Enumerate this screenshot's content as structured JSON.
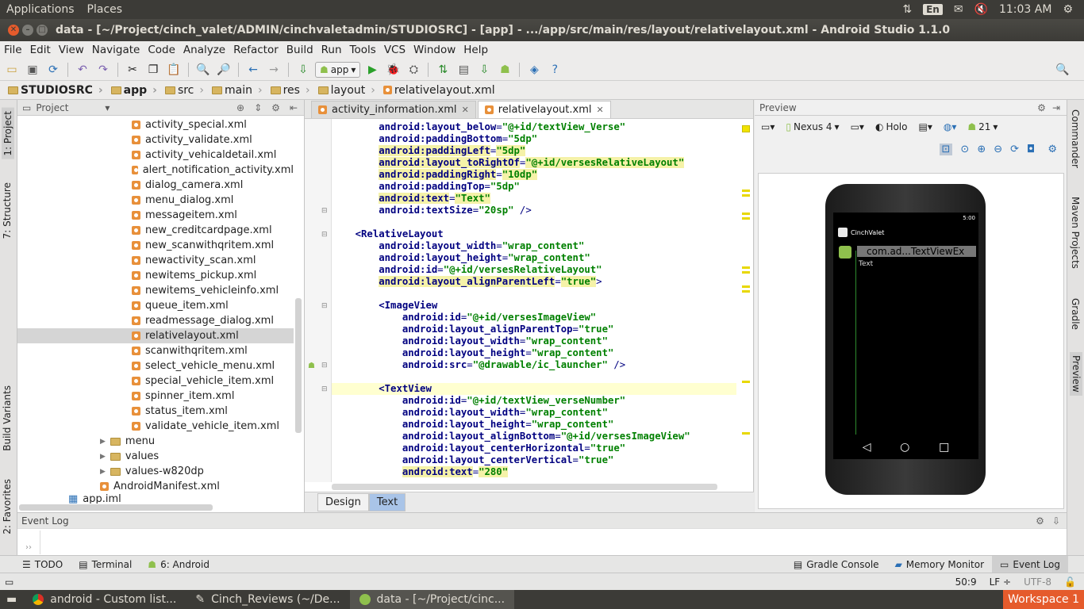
{
  "topbar": {
    "applications": "Applications",
    "places": "Places",
    "lang": "En",
    "time": "11:03 AM"
  },
  "window": {
    "title": "data - [~/Project/cinch_valet/ADMIN/cinchvaletadmin/STUDIOSRC] - [app] - .../app/src/main/res/layout/relativelayout.xml - Android Studio 1.1.0"
  },
  "menu": [
    "File",
    "Edit",
    "View",
    "Navigate",
    "Code",
    "Analyze",
    "Refactor",
    "Build",
    "Run",
    "Tools",
    "VCS",
    "Window",
    "Help"
  ],
  "toolbar": {
    "run_config": "app"
  },
  "breadcrumbs": [
    "STUDIOSRC",
    "app",
    "src",
    "main",
    "res",
    "layout",
    "relativelayout.xml"
  ],
  "sidestrip": {
    "project": "1: Project",
    "structure": "7: Structure",
    "build_variants": "Build Variants",
    "favorites": "2: Favorites"
  },
  "rightstrip": {
    "commander": "Commander",
    "maven": "Maven Projects",
    "gradle": "Gradle",
    "preview": "Preview"
  },
  "project": {
    "header": "Project",
    "files": [
      "activity_special.xml",
      "activity_validate.xml",
      "activity_vehicaldetail.xml",
      "alert_notification_activity.xml",
      "dialog_camera.xml",
      "menu_dialog.xml",
      "messageitem.xml",
      "new_creditcardpage.xml",
      "new_scanwithqritem.xml",
      "newactivity_scan.xml",
      "newitems_pickup.xml",
      "newitems_vehicleinfo.xml",
      "queue_item.xml",
      "readmessage_dialog.xml",
      "relativelayout.xml",
      "scanwithqritem.xml",
      "select_vehicle_menu.xml",
      "special_vehicle_item.xml",
      "spinner_item.xml",
      "status_item.xml",
      "validate_vehicle_item.xml"
    ],
    "folders": [
      "menu",
      "values",
      "values-w820dp"
    ],
    "manifest": "AndroidManifest.xml",
    "iml": "app.iml"
  },
  "editor": {
    "tabs": [
      "activity_information.xml",
      "relativelayout.xml"
    ],
    "bottom_tabs": [
      "Design",
      "Text"
    ]
  },
  "code": [
    [
      "        ",
      [
        [
          "a",
          "android:layout_below"
        ],
        [
          "p",
          "="
        ],
        [
          "v",
          "\"@+id/textView_Verse\""
        ]
      ]
    ],
    [
      "        ",
      [
        [
          "a",
          "android:paddingBottom"
        ],
        [
          "p",
          "="
        ],
        [
          "v",
          "\"5dp\""
        ]
      ]
    ],
    [
      "        ",
      [
        [
          "h",
          "android:paddingLeft"
        ],
        [
          "p",
          "="
        ],
        [
          "hv",
          "\"5dp\""
        ]
      ]
    ],
    [
      "        ",
      [
        [
          "h",
          "android:layout_toRightOf"
        ],
        [
          "p",
          "="
        ],
        [
          "hv",
          "\"@+id/versesRelativeLayout\""
        ]
      ]
    ],
    [
      "        ",
      [
        [
          "h",
          "android:paddingRight"
        ],
        [
          "p",
          "="
        ],
        [
          "hv",
          "\"10dp\""
        ]
      ]
    ],
    [
      "        ",
      [
        [
          "a",
          "android:paddingTop"
        ],
        [
          "p",
          "="
        ],
        [
          "v",
          "\"5dp\""
        ]
      ]
    ],
    [
      "        ",
      [
        [
          "h",
          "android:text"
        ],
        [
          "p",
          "="
        ],
        [
          "hv",
          "\"Text\""
        ]
      ]
    ],
    [
      "        ",
      [
        [
          "a",
          "android:textSize"
        ],
        [
          "p",
          "="
        ],
        [
          "v",
          "\"20sp\""
        ],
        [
          "p",
          " />"
        ]
      ]
    ],
    [
      "",
      []
    ],
    [
      "    ",
      [
        [
          "t",
          "<RelativeLayout"
        ]
      ]
    ],
    [
      "        ",
      [
        [
          "a",
          "android:layout_width"
        ],
        [
          "p",
          "="
        ],
        [
          "v",
          "\"wrap_content\""
        ]
      ]
    ],
    [
      "        ",
      [
        [
          "a",
          "android:layout_height"
        ],
        [
          "p",
          "="
        ],
        [
          "v",
          "\"wrap_content\""
        ]
      ]
    ],
    [
      "        ",
      [
        [
          "a",
          "android:id"
        ],
        [
          "p",
          "="
        ],
        [
          "v",
          "\"@+id/versesRelativeLayout\""
        ]
      ]
    ],
    [
      "        ",
      [
        [
          "h",
          "android:layout_alignParentLeft"
        ],
        [
          "p",
          "="
        ],
        [
          "hv",
          "\"true\""
        ],
        [
          "p",
          ">"
        ]
      ]
    ],
    [
      "",
      []
    ],
    [
      "        ",
      [
        [
          "t",
          "<ImageView"
        ]
      ]
    ],
    [
      "            ",
      [
        [
          "a",
          "android:id"
        ],
        [
          "p",
          "="
        ],
        [
          "v",
          "\"@+id/versesImageView\""
        ]
      ]
    ],
    [
      "            ",
      [
        [
          "a",
          "android:layout_alignParentTop"
        ],
        [
          "p",
          "="
        ],
        [
          "v",
          "\"true\""
        ]
      ]
    ],
    [
      "            ",
      [
        [
          "a",
          "android:layout_width"
        ],
        [
          "p",
          "="
        ],
        [
          "v",
          "\"wrap_content\""
        ]
      ]
    ],
    [
      "            ",
      [
        [
          "a",
          "android:layout_height"
        ],
        [
          "p",
          "="
        ],
        [
          "v",
          "\"wrap_content\""
        ]
      ]
    ],
    [
      "            ",
      [
        [
          "a",
          "android:src"
        ],
        [
          "p",
          "="
        ],
        [
          "v",
          "\"@drawable/ic_launcher\""
        ],
        [
          "p",
          " />"
        ]
      ]
    ],
    [
      "",
      []
    ],
    [
      "        ",
      [
        [
          "t",
          "<TextView"
        ]
      ]
    ],
    [
      "            ",
      [
        [
          "a",
          "android:id"
        ],
        [
          "p",
          "="
        ],
        [
          "v",
          "\"@+id/textView_verseNumber\""
        ]
      ]
    ],
    [
      "            ",
      [
        [
          "a",
          "android:layout_width"
        ],
        [
          "p",
          "="
        ],
        [
          "v",
          "\"wrap_content\""
        ]
      ]
    ],
    [
      "            ",
      [
        [
          "a",
          "android:layout_height"
        ],
        [
          "p",
          "="
        ],
        [
          "v",
          "\"wrap_content\""
        ]
      ]
    ],
    [
      "            ",
      [
        [
          "a",
          "android:layout_alignBottom"
        ],
        [
          "p",
          "="
        ],
        [
          "v",
          "\"@+id/versesImageView\""
        ]
      ]
    ],
    [
      "            ",
      [
        [
          "a",
          "android:layout_centerHorizontal"
        ],
        [
          "p",
          "="
        ],
        [
          "v",
          "\"true\""
        ]
      ]
    ],
    [
      "            ",
      [
        [
          "a",
          "android:layout_centerVertical"
        ],
        [
          "p",
          "="
        ],
        [
          "v",
          "\"true\""
        ]
      ]
    ],
    [
      "            ",
      [
        [
          "h",
          "android:text"
        ],
        [
          "p",
          "="
        ],
        [
          "hv",
          "\"280\""
        ]
      ]
    ]
  ],
  "preview": {
    "header": "Preview",
    "device": "Nexus 4",
    "theme": "Holo",
    "api": "21",
    "phone": {
      "time": "5:00",
      "app_name": "CinchValet",
      "text_ex": "com.ad...TextViewEx",
      "text": "Text"
    }
  },
  "eventlog": {
    "title": "Event Log"
  },
  "bottom_tabs": {
    "todo": "TODO",
    "terminal": "Terminal",
    "android": "6: Android",
    "gradle_console": "Gradle Console",
    "memory_monitor": "Memory Monitor",
    "event_log": "Event Log"
  },
  "status": {
    "position": "50:9",
    "line_sep": "LF",
    "encoding": "UTF-8"
  },
  "taskbar": {
    "items": [
      "android - Custom list...",
      "Cinch_Reviews (~/De...",
      "data - [~/Project/cinc..."
    ],
    "workspace": "Workspace 1"
  }
}
